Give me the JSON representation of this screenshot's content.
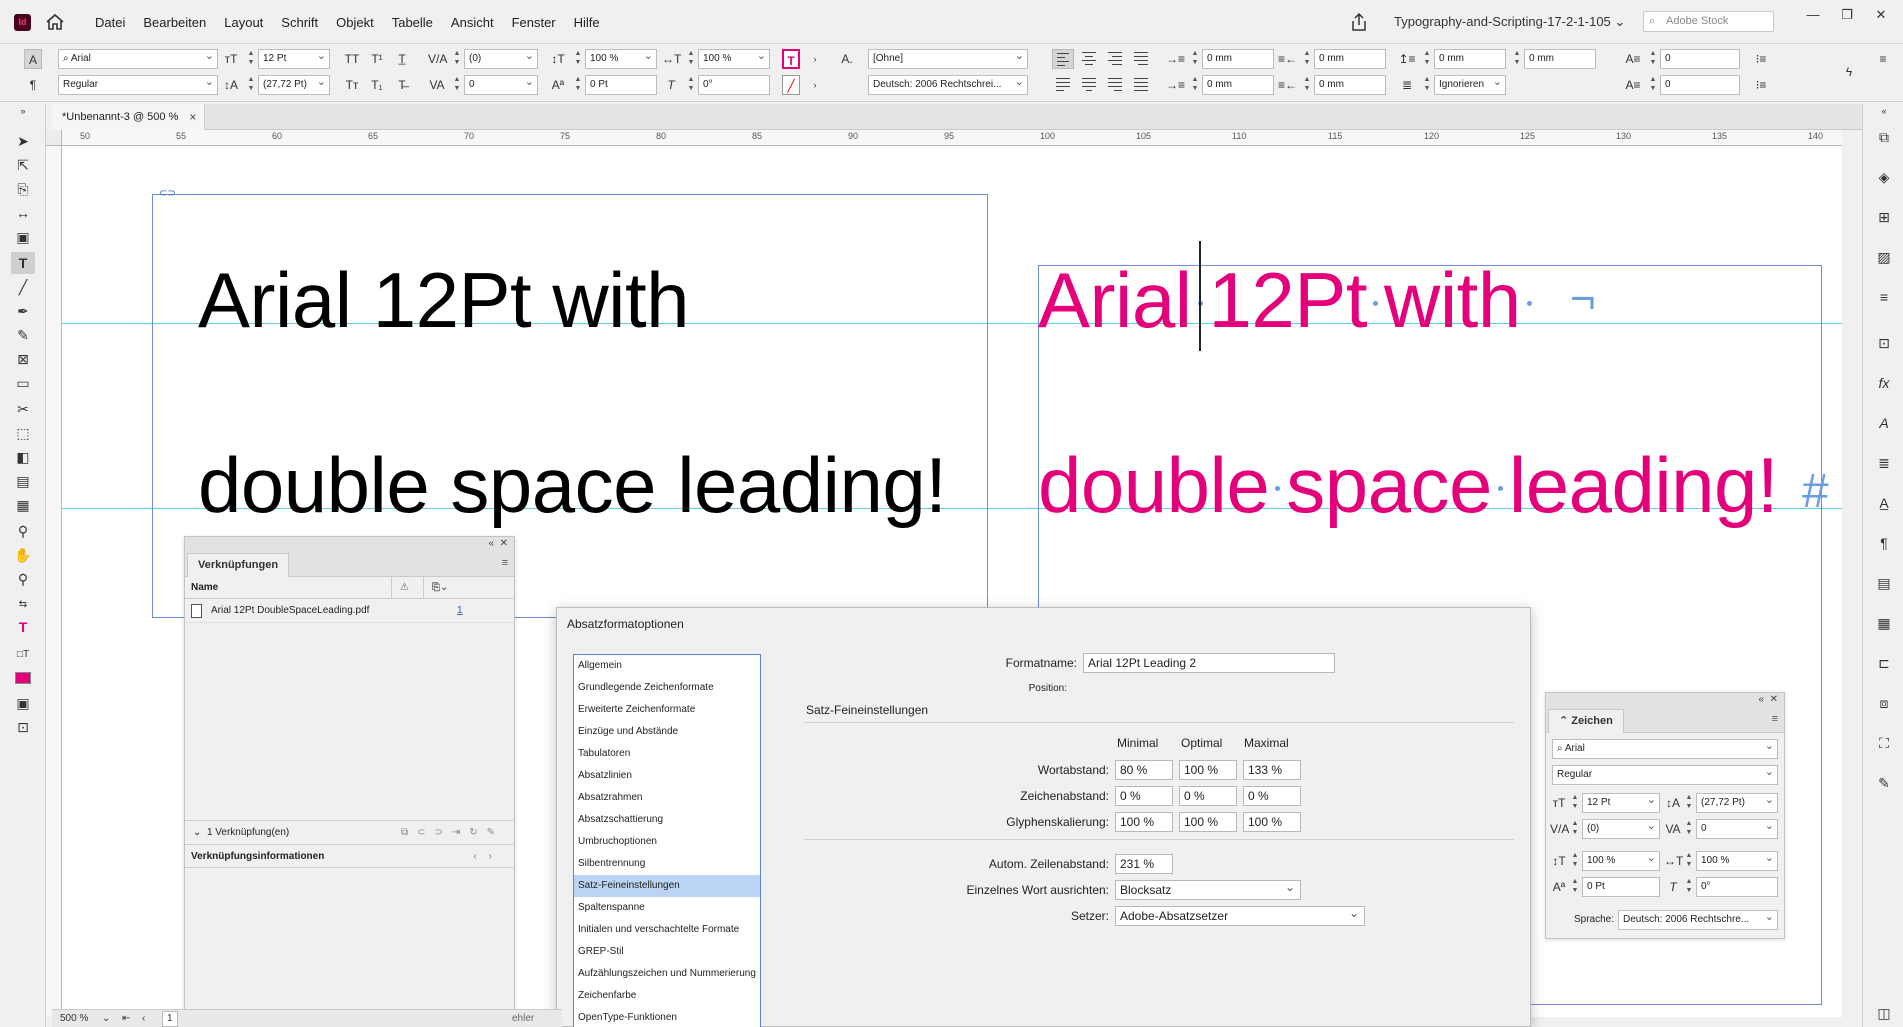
{
  "app": {
    "logo": "Id"
  },
  "menu": [
    "Datei",
    "Bearbeiten",
    "Layout",
    "Schrift",
    "Objekt",
    "Tabelle",
    "Ansicht",
    "Fenster",
    "Hilfe"
  ],
  "workspace": "Typography-and-Scripting-17-2-1-105",
  "stock_placeholder": "Adobe Stock",
  "control": {
    "font": "Arial",
    "style": "Regular",
    "size": "12 Pt",
    "leading": "(27,72 Pt)",
    "kerning": "(0)",
    "tracking": "0",
    "vscale": "100 %",
    "hscale": "100 %",
    "baseline": "0 Pt",
    "skew": "0°",
    "char_style": "[Ohne]",
    "language": "Deutsch: 2006 Rechtschrei...",
    "indent_left": "0 mm",
    "indent_first": "0 mm",
    "indent_right": "0 mm",
    "indent_last": "0 mm",
    "space_before": "0 mm",
    "space_after": "0 mm",
    "drop_lines": "0",
    "drop_chars": "0",
    "grid": "Ignorieren"
  },
  "doc_tab": {
    "title": "*Unbenannt-3 @ 500 %",
    "close": "×"
  },
  "ruler_ticks": [
    "50",
    "55",
    "60",
    "65",
    "70",
    "75",
    "80",
    "85",
    "90",
    "95",
    "100",
    "105",
    "110",
    "115",
    "120",
    "125",
    "130",
    "135",
    "140"
  ],
  "canvas": {
    "left_line1": "Arial 12Pt with",
    "left_line2": "double space leading!",
    "right_line1_a": "Arial",
    "right_line1_b": "12Pt",
    "right_line1_c": "with",
    "right_line2_a": "double",
    "right_line2_b": "space",
    "right_line2_c": "leading!",
    "line_end_mark": "¬",
    "story_end_mark": "#"
  },
  "links_panel": {
    "tab": "Verknüpfungen",
    "col_name": "Name",
    "file": "Arial 12Pt DoubleSpaceLeading.pdf",
    "page": "1",
    "count": "1 Verknüpfung(en)",
    "info": "Verknüpfungsinformationen"
  },
  "dialog": {
    "title": "Absatzformatoptionen",
    "categories": [
      "Allgemein",
      "Grundlegende Zeichenformate",
      "Erweiterte Zeichenformate",
      "Einzüge und Abstände",
      "Tabulatoren",
      "Absatzlinien",
      "Absatzrahmen",
      "Absatzschattierung",
      "Umbruchoptionen",
      "Silbentrennung",
      "Satz-Feineinstellungen",
      "Spaltenspanne",
      "Initialen und verschachtelte Formate",
      "GREP-Stil",
      "Aufzählungszeichen und Nummerierung",
      "Zeichenfarbe",
      "OpenType-Funktionen"
    ],
    "selected_category": 10,
    "format_name_label": "Formatname:",
    "format_name": "Arial 12Pt Leading 2",
    "position_label": "Position:",
    "section": "Satz-Feineinstellungen",
    "col_min": "Minimal",
    "col_opt": "Optimal",
    "col_max": "Maximal",
    "word_label": "Wortabstand:",
    "word": [
      "80 %",
      "100 %",
      "133 %"
    ],
    "letter_label": "Zeichenabstand:",
    "letter": [
      "0 %",
      "0 %",
      "0 %"
    ],
    "glyph_label": "Glyphenskalierung:",
    "glyph": [
      "100 %",
      "100 %",
      "100 %"
    ],
    "auto_leading_label": "Autom. Zeilenabstand:",
    "auto_leading": "231 %",
    "single_word_label": "Einzelnes Wort ausrichten:",
    "single_word": "Blocksatz",
    "composer_label": "Setzer:",
    "composer": "Adobe-Absatzsetzer"
  },
  "char_panel": {
    "title": "Zeichen",
    "font": "Arial",
    "style": "Regular",
    "size": "12 Pt",
    "leading": "(27,72 Pt)",
    "kerning": "(0)",
    "tracking": "0",
    "vscale": "100 %",
    "hscale": "100 %",
    "baseline": "0 Pt",
    "skew": "0°",
    "language_label": "Sprache:",
    "language": "Deutsch: 2006 Rechtschre..."
  },
  "status": {
    "zoom": "500 %",
    "page": "1",
    "error": "ehler"
  },
  "colors": {
    "magenta": "#e4007a",
    "frame": "#6b8fd6",
    "guide": "#5fd3e3"
  }
}
